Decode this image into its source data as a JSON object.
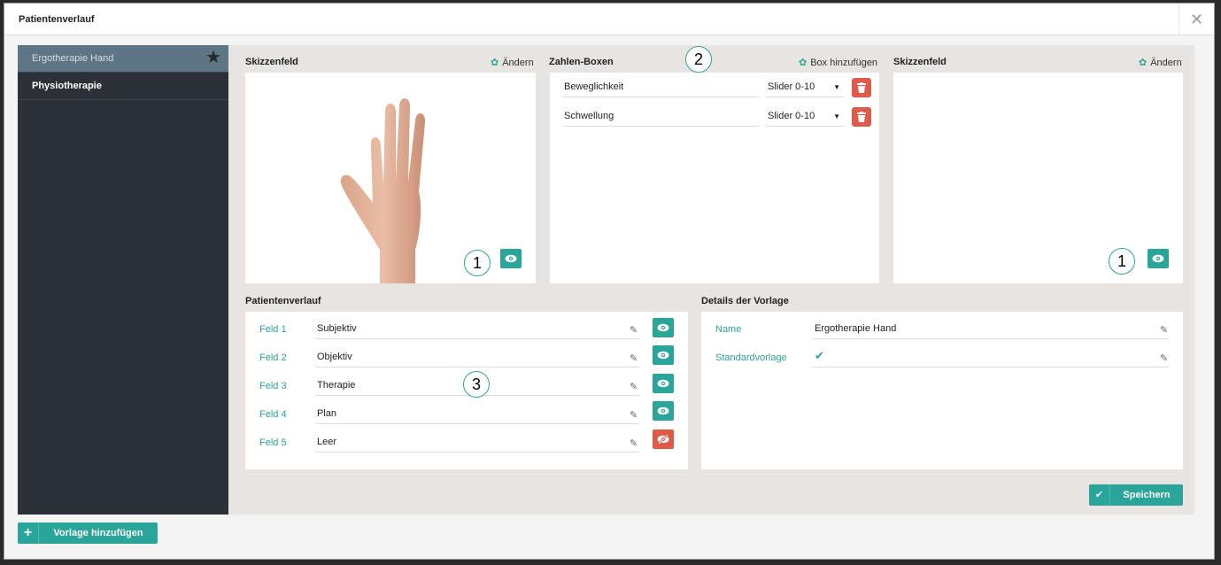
{
  "window": {
    "title": "Patientenverlauf",
    "close_symbol": "✕"
  },
  "sidebar": {
    "items": [
      {
        "label": "Ergotherapie Hand",
        "active": true,
        "starred": true
      },
      {
        "label": "Physiotherapie",
        "active": false,
        "starred": false
      }
    ],
    "add_button_label": "Vorlage hinzufügen"
  },
  "sketch_left": {
    "title": "Skizzenfeld",
    "action_label": "Ändern",
    "callout": "1"
  },
  "number_boxes": {
    "title": "Zahlen-Boxen",
    "action_label": "Box hinzufügen",
    "callout": "2",
    "rows": [
      {
        "name": "Beweglichkeit",
        "type": "Slider 0-10"
      },
      {
        "name": "Schwellung",
        "type": "Slider 0-10"
      }
    ]
  },
  "sketch_right": {
    "title": "Skizzenfeld",
    "action_label": "Ändern",
    "callout": "1"
  },
  "patient_history": {
    "title": "Patientenverlauf",
    "callout": "3",
    "fields": [
      {
        "label": "Feld 1",
        "value": "Subjektiv",
        "visible": true
      },
      {
        "label": "Feld 2",
        "value": "Objektiv",
        "visible": true
      },
      {
        "label": "Feld 3",
        "value": "Therapie",
        "visible": true
      },
      {
        "label": "Feld 4",
        "value": "Plan",
        "visible": true
      },
      {
        "label": "Feld 5",
        "value": "Leer",
        "visible": false
      }
    ]
  },
  "template_details": {
    "title": "Details der Vorlage",
    "name_label": "Name",
    "name_value": "Ergotherapie Hand",
    "default_label": "Standardvorlage",
    "default_checked": true
  },
  "footer": {
    "save_label": "Speichern"
  },
  "colors": {
    "accent": "#2aa59a",
    "danger": "#e05a4a",
    "sidebar": "#2c3138",
    "sidebar_active": "#5d7585"
  }
}
